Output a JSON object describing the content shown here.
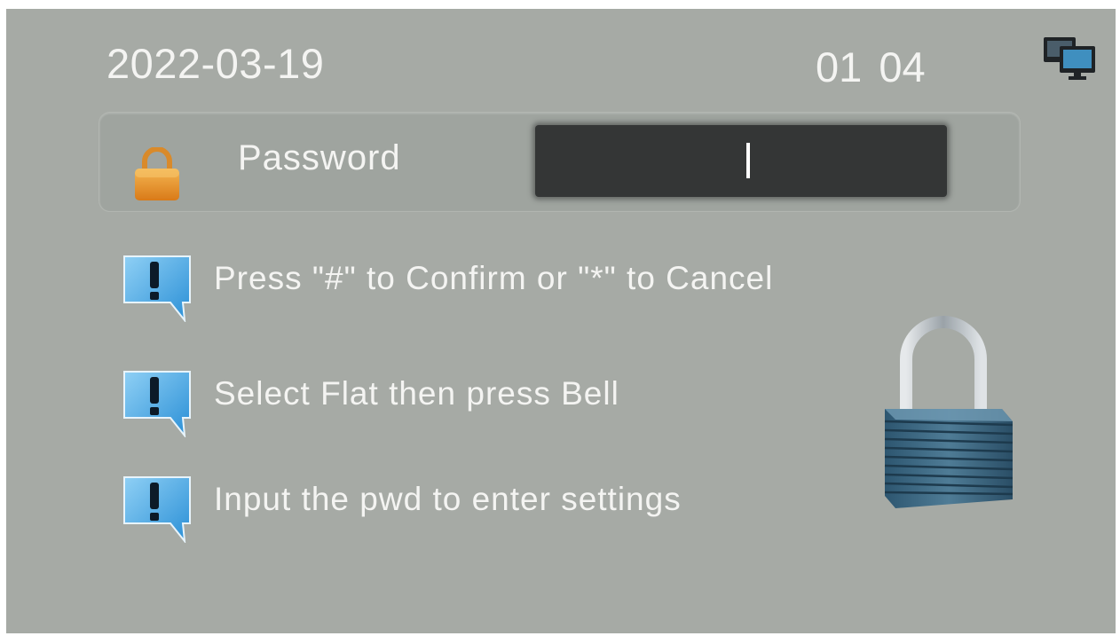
{
  "status_bar": {
    "date": "2022-03-19",
    "time": "01 04",
    "network_icon": "monitor-icon"
  },
  "password_panel": {
    "icon": "lock-icon",
    "label": "Password",
    "value": "",
    "cursor": "|"
  },
  "hints": [
    {
      "icon": "exclamation-speech-bubble-icon",
      "text": "Press \"#\" to Confirm or \"*\" to Cancel"
    },
    {
      "icon": "exclamation-speech-bubble-icon",
      "text": "Select Flat then press Bell"
    },
    {
      "icon": "exclamation-speech-bubble-icon",
      "text": "Input the pwd to enter settings"
    }
  ],
  "decoration": {
    "icon": "padlock-icon"
  },
  "colors": {
    "background": "#a6aaa5",
    "text": "#f4f4f2",
    "input_background": "#343636",
    "small_lock": "#e8962e",
    "hint_icon": "#3aa3e3",
    "padlock_body": "#3d6680"
  }
}
